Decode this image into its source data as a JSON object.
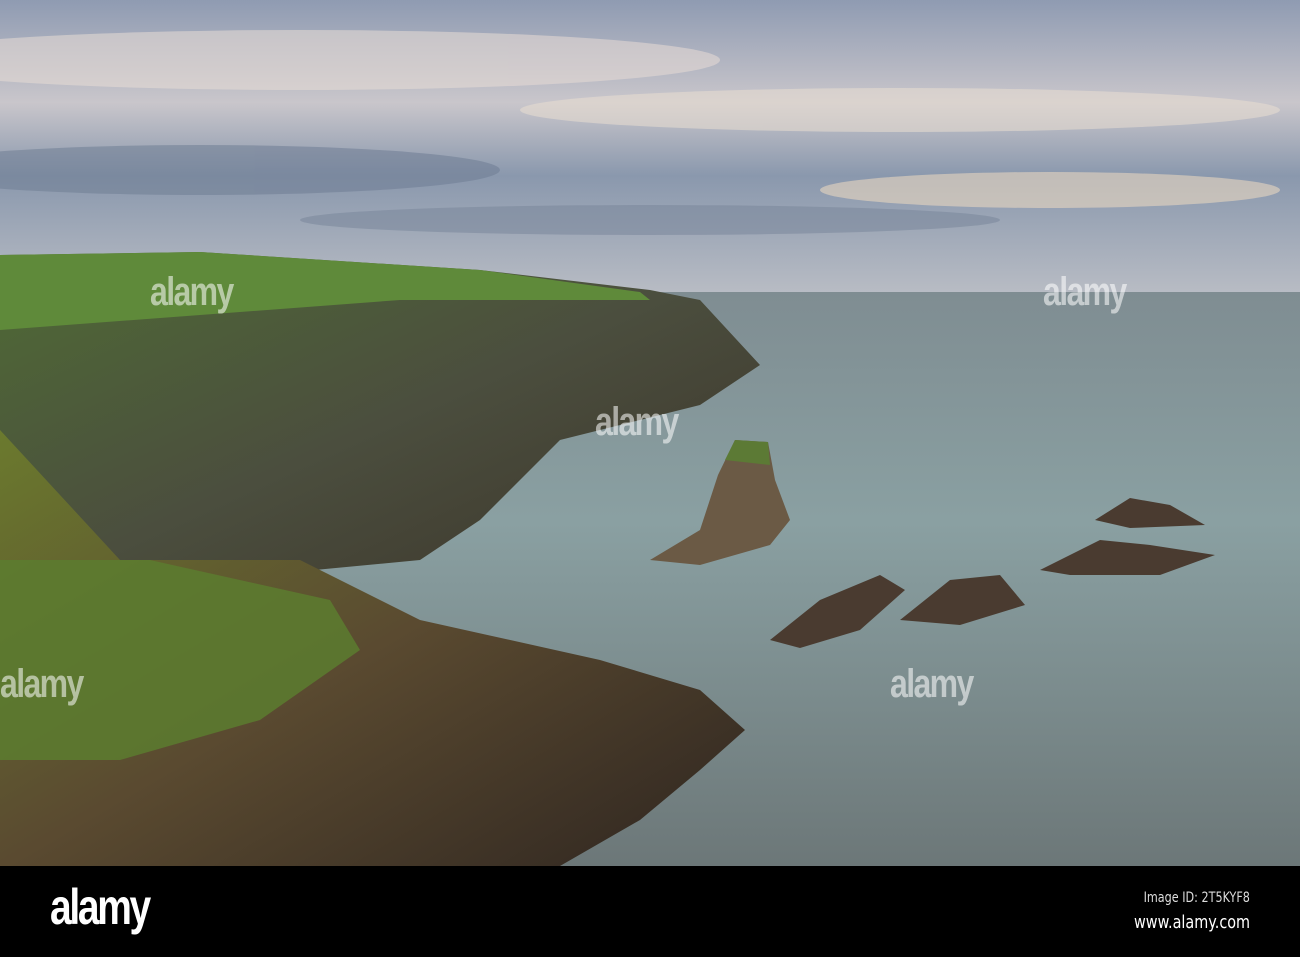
{
  "photo": {
    "subject": "coastal cliffs and sea stack"
  },
  "watermark": {
    "text": "alamy"
  },
  "footer": {
    "logo": "alamy",
    "image_id": "Image ID: 2T5KYF8",
    "website": "www.alamy.com"
  }
}
